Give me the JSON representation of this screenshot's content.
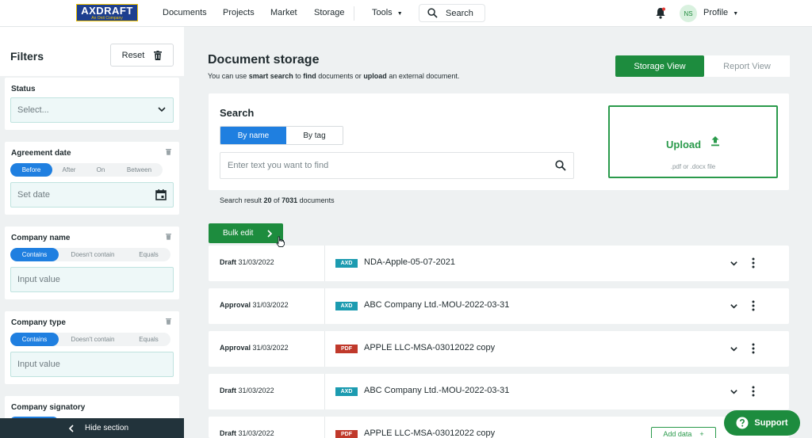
{
  "logo": {
    "name": "AXDRAFT",
    "sub": "An Onit Company"
  },
  "nav": {
    "items": [
      "Documents",
      "Projects",
      "Market",
      "Storage"
    ],
    "tools": "Tools",
    "search": "Search",
    "avatar_initials": "NS",
    "profile": "Profile"
  },
  "filters": {
    "title": "Filters",
    "reset": "Reset",
    "status": {
      "label": "Status",
      "placeholder": "Select..."
    },
    "agreement_date": {
      "label": "Agreement date",
      "options": [
        "Before",
        "After",
        "On",
        "Between"
      ],
      "placeholder": "Set date"
    },
    "company_name": {
      "label": "Company name",
      "options": [
        "Contains",
        "Doesn't contain",
        "Equals"
      ],
      "placeholder": "Input value"
    },
    "company_type": {
      "label": "Company type",
      "options": [
        "Contains",
        "Doesn't contain",
        "Equals"
      ],
      "placeholder": "Input value"
    },
    "company_signatory": {
      "label": "Company signatory"
    },
    "hide_section": "Hide section"
  },
  "main": {
    "title": "Document storage",
    "subtitle_parts": [
      "You can use ",
      "smart search",
      " to ",
      "find",
      " documents or ",
      "upload",
      " an external document."
    ],
    "views": {
      "active": "Storage View",
      "inactive": "Report View"
    },
    "search": {
      "title": "Search",
      "tabs": [
        "By name",
        "By tag"
      ],
      "placeholder": "Enter text you want to find"
    },
    "upload": {
      "title": "Upload",
      "sub": ".pdf or .docx file"
    },
    "result": {
      "prefix": "Search result ",
      "count": "20",
      "mid": " of ",
      "total": "7031",
      "suffix": " documents"
    },
    "bulk_edit": "Bulk edit",
    "rows": [
      {
        "status": "Draft",
        "date": "31/03/2022",
        "type": "AXD",
        "name": "NDA-Apple-05-07-2021"
      },
      {
        "status": "Approval",
        "date": "31/03/2022",
        "type": "AXD",
        "name": "ABC Company Ltd.-MOU-2022-03-31"
      },
      {
        "status": "Approval",
        "date": "31/03/2022",
        "type": "PDF",
        "name": "APPLE LLC-MSA-03012022 copy"
      },
      {
        "status": "Draft",
        "date": "31/03/2022",
        "type": "AXD",
        "name": "ABC Company Ltd.-MOU-2022-03-31"
      },
      {
        "status": "Draft",
        "date": "31/03/2022",
        "type": "PDF",
        "name": "APPLE LLC-MSA-03012022 copy"
      }
    ],
    "add_data": "Add data",
    "support": "Support"
  },
  "colors": {
    "brand_green": "#1d8c3e",
    "accent_blue": "#1f7fe0",
    "axd_badge": "#1c9bb0",
    "pdf_badge": "#c0392b"
  }
}
